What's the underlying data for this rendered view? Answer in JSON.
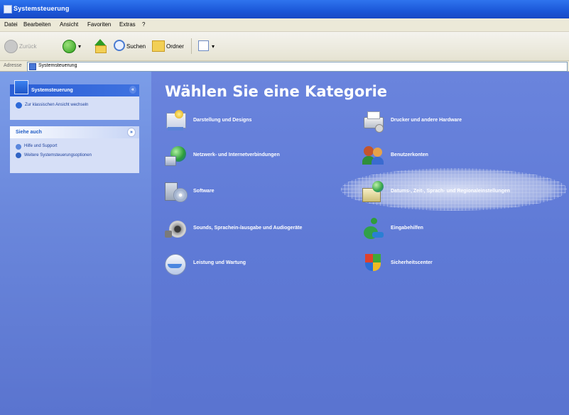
{
  "window": {
    "title": "Systemsteuerung"
  },
  "menu": {
    "items": [
      "Datei",
      "Bearbeiten",
      "Ansicht",
      "Favoriten",
      "Extras",
      "?"
    ]
  },
  "toolbar": {
    "back_label": "Zurück",
    "search_label": "Suchen",
    "folders_label": "Ordner"
  },
  "address": {
    "label": "Adresse",
    "value": "Systemsteuerung"
  },
  "left_pane": {
    "panel_title": "Systemsteuerung",
    "switch_link": "Zur klassischen Ansicht wechseln",
    "see_also_title": "Siehe auch",
    "see_also": [
      "Hilfe und Support",
      "Weitere Systemsteuerungsoptionen"
    ]
  },
  "main": {
    "heading": "Wählen Sie eine Kategorie",
    "categories": [
      "Darstellung und Designs",
      "Drucker und andere Hardware",
      "Netzwerk- und Internetverbindungen",
      "Benutzerkonten",
      "Software",
      "Datums-, Zeit-, Sprach- und Regionaleinstellungen",
      "Sounds, Sprachein-/ausgabe und Audiogeräte",
      "Eingabehilfen",
      "Leistung und Wartung",
      "Sicherheitscenter"
    ],
    "highlighted_category": "Datums-, Zeit-, Sprach- und Regionaleinstellungen"
  },
  "colors": {
    "title_bar": "#1b57d8",
    "main_pane": "#5f7ad6",
    "left_pane": "#6b88dc",
    "box": "#d6dff7"
  }
}
